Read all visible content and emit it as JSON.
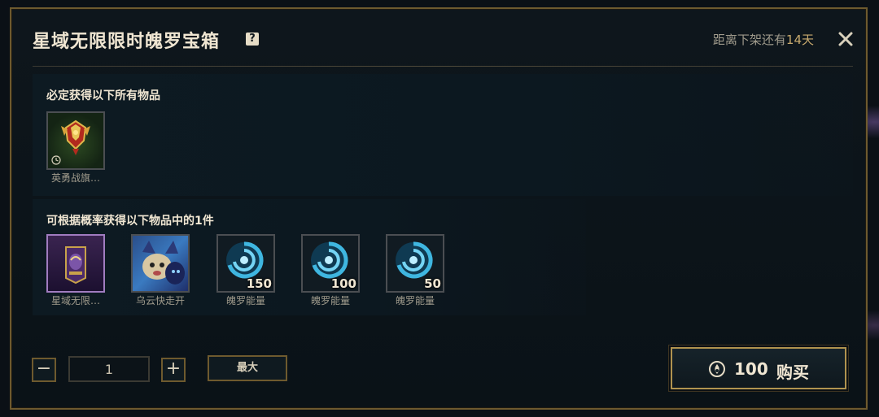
{
  "header": {
    "title": "星域无限限时魄罗宝箱",
    "help_icon": "?",
    "expiry_prefix": "距离下架还有",
    "expiry_days": "14天",
    "close_icon": "close-icon"
  },
  "guaranteed": {
    "title": "必定获得以下所有物品",
    "items": [
      {
        "label": "英勇战旗…",
        "icon": "banner-emblem-icon",
        "timed": true
      }
    ]
  },
  "chance": {
    "title": "可根据概率获得以下物品中的1件",
    "items": [
      {
        "label": "星域无限…",
        "icon": "star-domain-icon",
        "count": ""
      },
      {
        "label": "乌云快走开",
        "icon": "companion-icon",
        "count": ""
      },
      {
        "label": "魄罗能量",
        "icon": "poro-energy-icon",
        "count": "150"
      },
      {
        "label": "魄罗能量",
        "icon": "poro-energy-icon",
        "count": "100"
      },
      {
        "label": "魄罗能量",
        "icon": "poro-energy-icon",
        "count": "50"
      }
    ]
  },
  "controls": {
    "minus": "−",
    "quantity": "1",
    "plus": "+",
    "max_label": "最大",
    "price": "100",
    "buy_label": "购买",
    "currency_icon": "orange-essence-icon"
  },
  "colors": {
    "gold": "#c8aa6e",
    "border": "#6e5a2e",
    "text": "#f0e6d2"
  }
}
